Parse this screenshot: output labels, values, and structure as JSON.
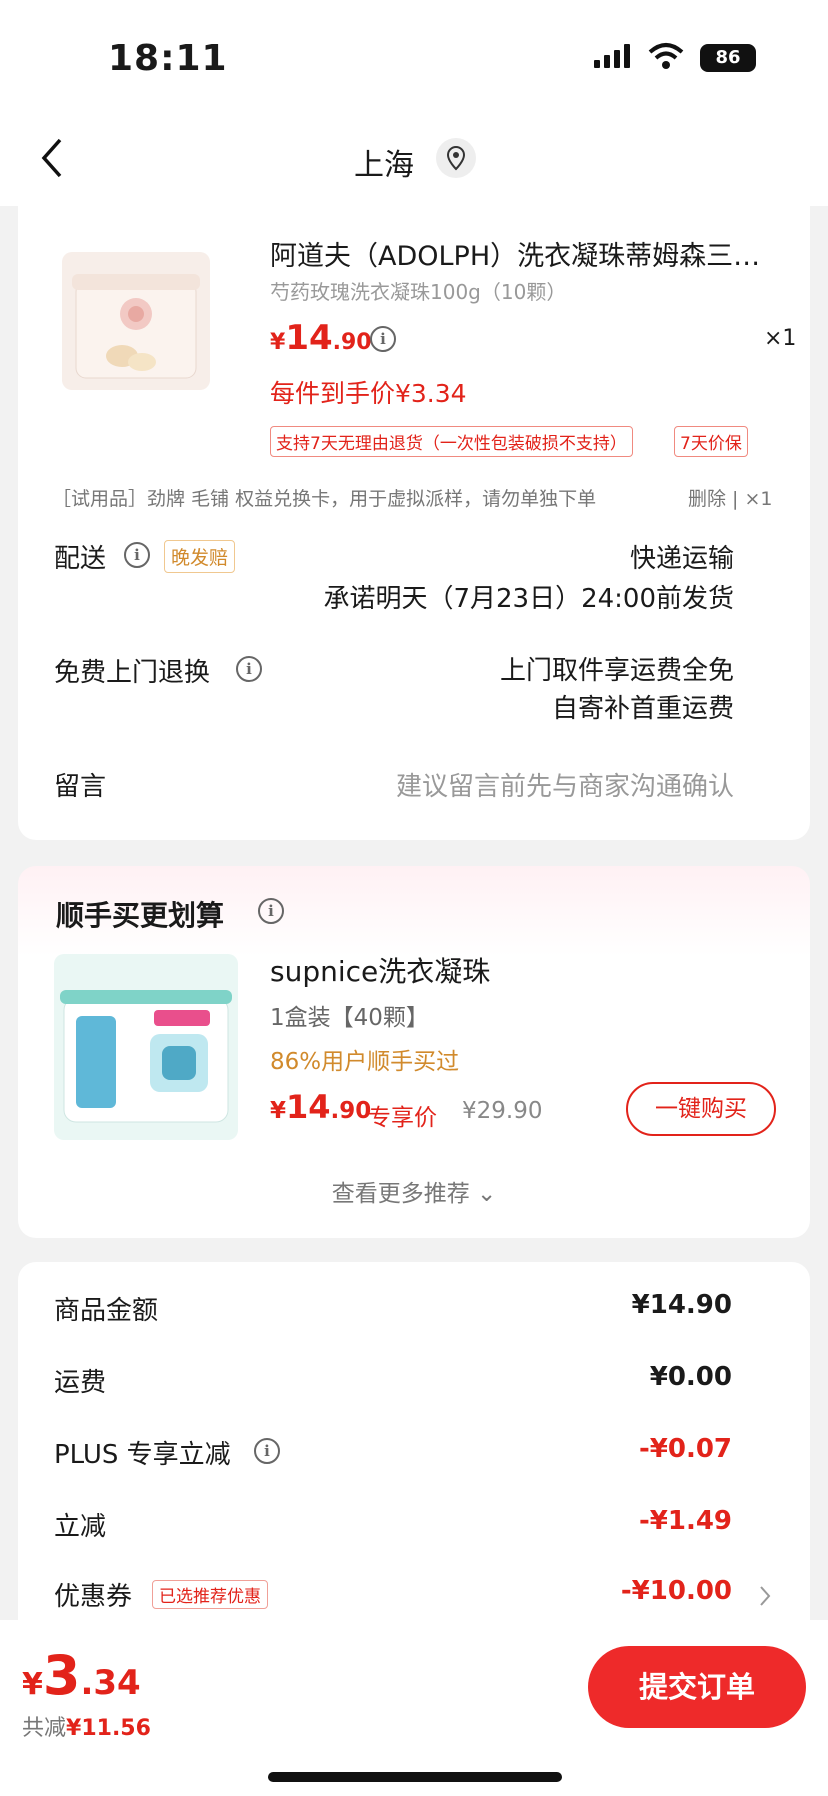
{
  "status": {
    "time": "18:11",
    "battery": "86"
  },
  "nav": {
    "location": "上海"
  },
  "product": {
    "name": "阿道夫（ADOLPH）洗衣凝珠蒂姆森三…",
    "spec": "芍药玫瑰洗衣凝珠100g（10颗）",
    "price_int": "14",
    "price_dec": ".90",
    "currency": "¥",
    "qty": "×1",
    "unit_price": "每件到手价¥3.34",
    "tag1": "支持7天无理由退货（一次性包装破损不支持）",
    "tag2": "7天价保"
  },
  "gift": {
    "text": "［试用品］劲牌 毛铺 权益兑换卡，用于虚拟派样，请勿单独下单",
    "action": "删除 | ×1"
  },
  "delivery": {
    "label": "配送",
    "badge": "晚发赔",
    "method": "快递运输",
    "promise": "承诺明天（7月23日）24:00前发货"
  },
  "returns": {
    "label": "免费上门退换",
    "line1": "上门取件享运费全免",
    "line2": "自寄补首重运费"
  },
  "message": {
    "label": "留言",
    "placeholder": "建议留言前先与商家沟通确认"
  },
  "recommend": {
    "title": "顺手买更划算",
    "name": "supnice洗衣凝珠",
    "spec": "1盒装【40颗】",
    "bought": "86%用户顺手买过",
    "price_int": "14",
    "price_dec": ".90",
    "currency": "¥",
    "price_label": "专享价",
    "orig_price": "¥29.90",
    "buy_label": "一键购买",
    "more": "查看更多推荐 ⌄"
  },
  "summary": {
    "rows": [
      {
        "label": "商品金额",
        "value": "¥14.90"
      },
      {
        "label": "运费",
        "value": "¥0.00"
      },
      {
        "label": "PLUS 专享立减",
        "value": "-¥0.07"
      },
      {
        "label": "立减",
        "value": "-¥1.49"
      },
      {
        "label": "优惠券",
        "value": "-¥10.00"
      }
    ],
    "coupon_badge": "已选推荐优惠"
  },
  "bottom": {
    "currency": "¥",
    "total_int": "3",
    "total_dec": ".34",
    "saved_label": "共减",
    "saved_value": "¥11.56",
    "submit": "提交订单"
  },
  "colors": {
    "accent": "#e2231a",
    "orange": "#d18a2c"
  }
}
